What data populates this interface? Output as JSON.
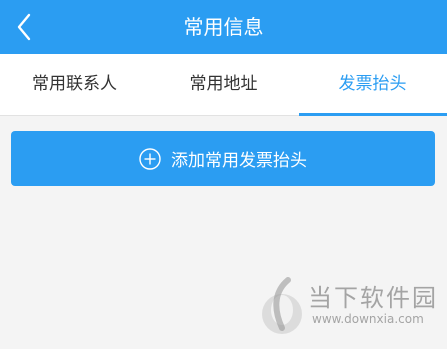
{
  "header": {
    "title": "常用信息",
    "back_icon": "chevron-left-icon"
  },
  "tabs": [
    {
      "label": "常用联系人",
      "active": false
    },
    {
      "label": "常用地址",
      "active": false
    },
    {
      "label": "发票抬头",
      "active": true
    }
  ],
  "main": {
    "add_button_label": "添加常用发票抬头",
    "add_button_icon": "plus-circle-icon"
  },
  "watermark": {
    "brand": "当下软件园",
    "url": "www.downxia.com"
  },
  "colors": {
    "accent": "#2b9df2",
    "background": "#f4f4f4",
    "tab_text": "#333333"
  }
}
